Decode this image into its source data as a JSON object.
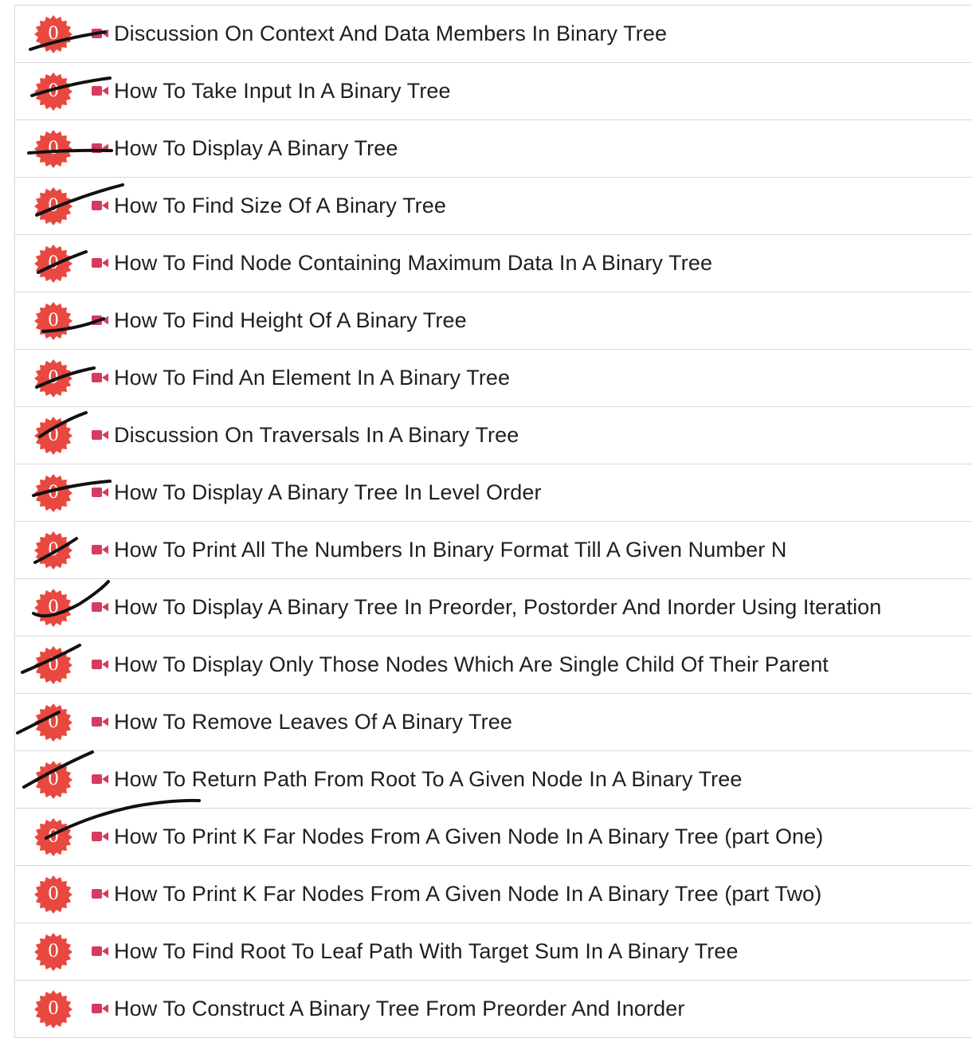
{
  "rows": [
    {
      "count": "0",
      "title": "Discussion On Context And Data Members In Binary Tree",
      "crossed": true
    },
    {
      "count": "0",
      "title": "How To Take Input In A Binary Tree",
      "crossed": true
    },
    {
      "count": "0",
      "title": "How To Display A Binary Tree",
      "crossed": true
    },
    {
      "count": "0",
      "title": "How To Find Size Of A Binary Tree",
      "crossed": true
    },
    {
      "count": "0",
      "title": "How To Find Node Containing Maximum Data In A Binary Tree",
      "crossed": true
    },
    {
      "count": "0",
      "title": "How To Find Height Of A Binary Tree",
      "crossed": true
    },
    {
      "count": "0",
      "title": "How To Find An Element In A Binary Tree",
      "crossed": true
    },
    {
      "count": "0",
      "title": "Discussion On Traversals In A Binary Tree",
      "crossed": true
    },
    {
      "count": "0",
      "title": "How To Display A Binary Tree In Level Order",
      "crossed": true
    },
    {
      "count": "0",
      "title": "How To Print All The Numbers In Binary Format Till A Given Number N",
      "crossed": true
    },
    {
      "count": "0",
      "title": "How To Display A Binary Tree In Preorder, Postorder And Inorder Using Iteration",
      "crossed": true
    },
    {
      "count": "0",
      "title": "How To Display Only Those Nodes Which Are Single Child Of Their Parent",
      "crossed": true
    },
    {
      "count": "0",
      "title": "How To Remove Leaves Of A Binary Tree",
      "crossed": true
    },
    {
      "count": "0",
      "title": "How To Return Path From Root To A Given Node In A Binary Tree",
      "crossed": true
    },
    {
      "count": "0",
      "title": "How To Print K Far Nodes From A Given Node In A Binary Tree (part One)",
      "crossed": true
    },
    {
      "count": "0",
      "title": "How To Print K Far Nodes From A Given Node In A Binary Tree (part Two)",
      "crossed": false
    },
    {
      "count": "0",
      "title": "How To Find Root To Leaf Path With Target Sum In A Binary Tree",
      "crossed": false
    },
    {
      "count": "0",
      "title": "How To Construct A Binary Tree From Preorder And Inorder",
      "crossed": false
    }
  ],
  "colors": {
    "badge": "#e8483f",
    "video_icon": "#d63a5f",
    "ink": "#111111",
    "text": "#1f1f1f",
    "divider": "#d9d9d9"
  },
  "icons": {
    "badge": "starburst-badge-icon",
    "lesson": "video-camera-icon"
  }
}
